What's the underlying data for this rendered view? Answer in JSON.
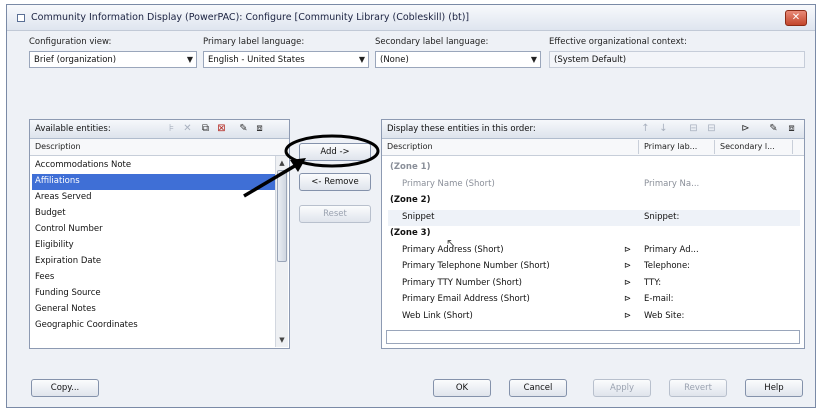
{
  "window": {
    "title": "Community Information Display (PowerPAC): Configure [Community Library (Cobleskill) (bt)]"
  },
  "config": {
    "view_label": "Configuration view:",
    "view_value": "Brief (organization)",
    "primary_lang_label": "Primary label language:",
    "primary_lang_value": "English - United States",
    "secondary_lang_label": "Secondary label language:",
    "secondary_lang_value": "(None)",
    "context_label": "Effective organizational context:",
    "context_value": "(System Default)"
  },
  "available": {
    "title": "Available entities:",
    "col_description": "Description",
    "items": [
      "Accommodations Note",
      "Affiliations",
      "Areas Served",
      "Budget",
      "Control Number",
      "Eligibility",
      "Expiration Date",
      "Fees",
      "Funding Source",
      "General Notes",
      "Geographic Coordinates"
    ],
    "selected_index": 1
  },
  "buttons": {
    "add": "Add ->",
    "remove": "<- Remove",
    "reset": "Reset",
    "copy": "Copy...",
    "ok": "OK",
    "cancel": "Cancel",
    "apply": "Apply",
    "revert": "Revert",
    "help": "Help"
  },
  "display": {
    "title": "Display these entities in this order:",
    "col_description": "Description",
    "col_primary": "Primary lab...",
    "col_secondary": "Secondary l...",
    "rows": [
      {
        "desc": "(Zone 1)",
        "primary": "",
        "zone": true,
        "muted": true
      },
      {
        "desc": "Primary Name (Short)",
        "primary": "Primary Na...",
        "zone": false,
        "muted": true
      },
      {
        "desc": "(Zone 2)",
        "primary": "",
        "zone": true,
        "muted": false
      },
      {
        "desc": "Snippet",
        "primary": "Snippet:",
        "zone": false,
        "muted": false
      },
      {
        "desc": "(Zone 3)",
        "primary": "",
        "zone": true,
        "muted": false
      },
      {
        "desc": "Primary Address (Short)",
        "primary": "Primary Ad...",
        "zone": false,
        "muted": false
      },
      {
        "desc": "Primary Telephone Number (Short)",
        "primary": "Telephone:",
        "zone": false,
        "muted": false
      },
      {
        "desc": "Primary TTY Number (Short)",
        "primary": "TTY:",
        "zone": false,
        "muted": false
      },
      {
        "desc": "Primary Email Address (Short)",
        "primary": "E-mail:",
        "zone": false,
        "muted": false
      },
      {
        "desc": "Web Link (Short)",
        "primary": "Web Site:",
        "zone": false,
        "muted": false
      }
    ]
  }
}
